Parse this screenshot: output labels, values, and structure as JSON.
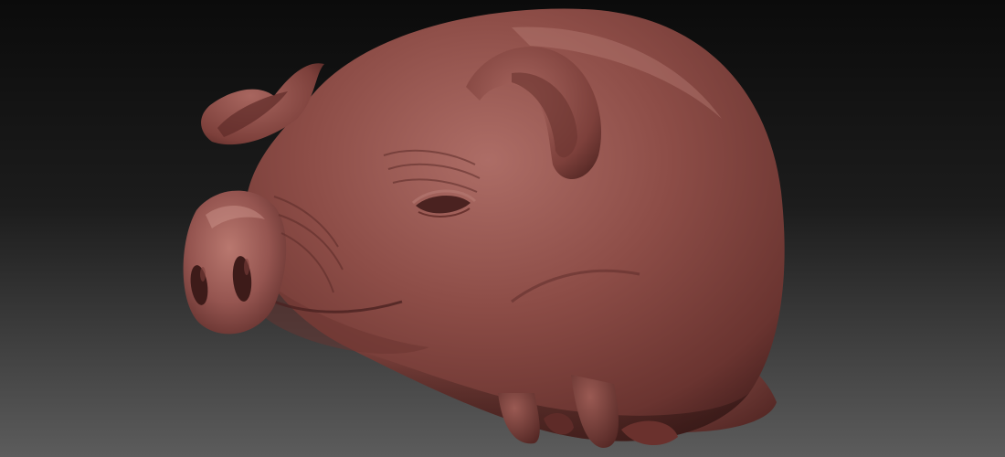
{
  "scene": {
    "subject": "pig-sculpt",
    "material_color": "#8a4a44",
    "material_highlight": "#b0706a",
    "material_shadow": "#4a2220",
    "background_top": "#0d0d0d",
    "background_bottom": "#5a5a5a"
  }
}
